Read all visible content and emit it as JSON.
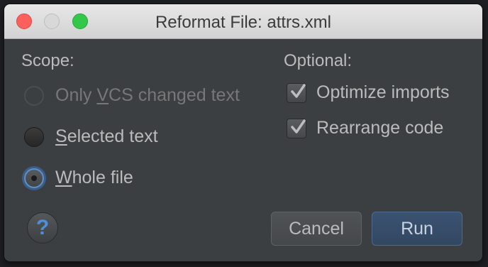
{
  "window": {
    "title": "Reformat File: attrs.xml"
  },
  "scope": {
    "label": "Scope:",
    "options": [
      {
        "prefix": "Only ",
        "accel": "V",
        "rest": "CS changed text",
        "state": "disabled"
      },
      {
        "prefix": "",
        "accel": "S",
        "rest": "elected text",
        "state": "unselected"
      },
      {
        "prefix": "",
        "accel": "W",
        "rest": "hole file",
        "state": "selected"
      }
    ]
  },
  "optional": {
    "label": "Optional:",
    "options": [
      {
        "label": "Optimize imports",
        "checked": true
      },
      {
        "label": "Rearrange code",
        "checked": true
      }
    ]
  },
  "help": {
    "glyph": "?"
  },
  "buttons": {
    "cancel": "Cancel",
    "run": "Run"
  },
  "colors": {
    "background": "#3c3f41",
    "accent": "#5e90c9",
    "run_button": "#365070"
  }
}
